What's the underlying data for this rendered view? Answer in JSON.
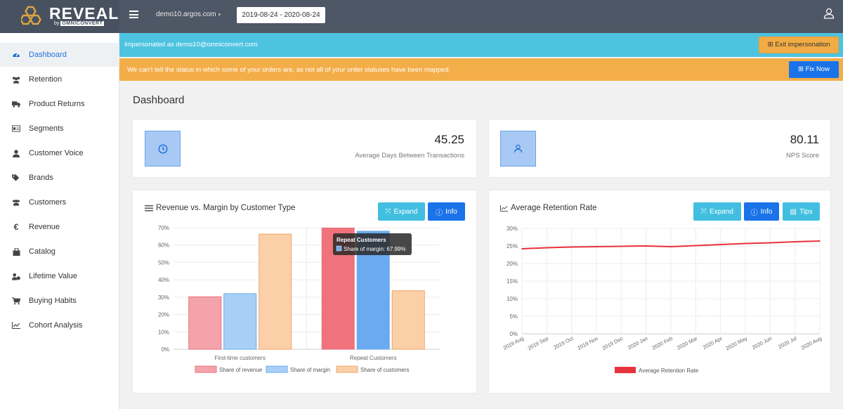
{
  "app": {
    "logo_text": "REVEAL",
    "logo_by": "by",
    "logo_brand": "OMNICONVERT",
    "account": "demo10.argos.com",
    "date_range": "2019-08-24 - 2020-08-24"
  },
  "sidebar": {
    "items": [
      {
        "label": "Dashboard",
        "icon": "tachometer-icon",
        "active": true
      },
      {
        "label": "Retention",
        "icon": "users-cog-icon"
      },
      {
        "label": "Product Returns",
        "icon": "truck-icon"
      },
      {
        "label": "Segments",
        "icon": "id-card-icon"
      },
      {
        "label": "Customer Voice",
        "icon": "user-icon"
      },
      {
        "label": "Brands",
        "icon": "tags-icon"
      },
      {
        "label": "Customers",
        "icon": "users-icon"
      },
      {
        "label": "Revenue",
        "icon": "euro-icon"
      },
      {
        "label": "Catalog",
        "icon": "shopping-bag-icon"
      },
      {
        "label": "Lifetime Value",
        "icon": "user-clock-icon"
      },
      {
        "label": "Buying Habits",
        "icon": "cart-icon"
      },
      {
        "label": "Cohort Analysis",
        "icon": "line-chart-icon"
      }
    ]
  },
  "banners": {
    "impersonation_text": "Impersonated as demo10@omniconvert.com",
    "exit_label": "Exit impersonation",
    "warning_text": "We can't tell the status in which some of your orders are, as not all of your order statuses have been mapped.",
    "fix_label": "Fix Now"
  },
  "page": {
    "title": "Dashboard"
  },
  "kpis": [
    {
      "value": "45.25",
      "label": "Average Days Between Transactions",
      "icon": "clock-icon"
    },
    {
      "value": "80.11",
      "label": "NPS Score",
      "icon": "user-icon"
    }
  ],
  "buttons": {
    "expand": "Expand",
    "info": "Info",
    "tips": "Tips"
  },
  "colors": {
    "revenue": "#f5a3ab",
    "margin": "#a8d0f6",
    "customers": "#fbd0a8",
    "revenue_hi": "#f0737c",
    "margin_hi": "#6aaaf0",
    "retention_line": "#e8323c",
    "accent_blue": "#1a73e8",
    "accent_cyan": "#42bfe0",
    "imp_banner": "#4ec3e0",
    "warn_banner": "#f3ae4a"
  },
  "chart_data": [
    {
      "type": "bar",
      "title": "Revenue vs. Margin by Customer Type",
      "categories": [
        "First-time customers",
        "Repeat Customers"
      ],
      "series": [
        {
          "name": "Share of revenue",
          "values": [
            30.2,
            69.8
          ]
        },
        {
          "name": "Share of margin",
          "values": [
            32.01,
            67.99
          ]
        },
        {
          "name": "Share of customers",
          "values": [
            66.3,
            33.7
          ]
        }
      ],
      "ylim": [
        0,
        70
      ],
      "yticks": [
        "0%",
        "10%",
        "20%",
        "30%",
        "40%",
        "50%",
        "60%",
        "70%"
      ],
      "legend": "bottom",
      "tooltip": {
        "title": "Repeat Customers",
        "text": "Share of margin: 67.99%"
      }
    },
    {
      "type": "line",
      "title": "Average Retention Rate",
      "x": [
        "2019 Aug",
        "2019 Sep",
        "2019 Oct",
        "2019 Nov",
        "2019 Dec",
        "2020 Jan",
        "2020 Feb",
        "2020 Mar",
        "2020 Apr",
        "2020 May",
        "2020 Jun",
        "2020 Jul",
        "2020 Aug"
      ],
      "series": [
        {
          "name": "Average Retention Rate",
          "values": [
            24.2,
            24.5,
            24.7,
            24.8,
            24.9,
            25.0,
            24.8,
            25.1,
            25.4,
            25.7,
            25.9,
            26.2,
            26.4
          ]
        }
      ],
      "ylim": [
        0,
        30
      ],
      "yticks": [
        "0%",
        "5%",
        "10%",
        "15%",
        "20%",
        "25%",
        "30%"
      ],
      "legend": "bottom"
    }
  ]
}
